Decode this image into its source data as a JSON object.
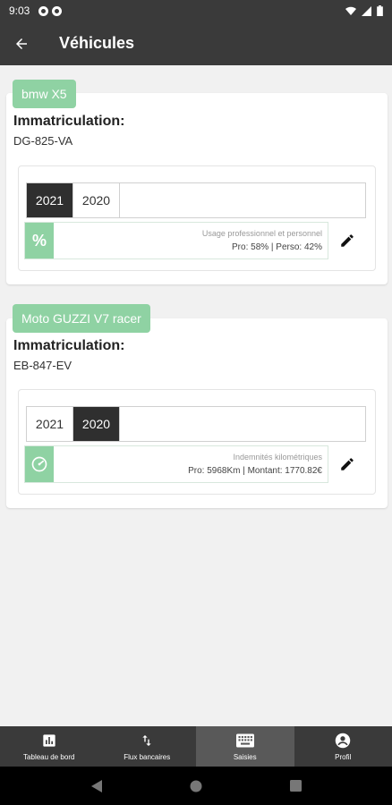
{
  "status_bar": {
    "time": "9:03"
  },
  "app_bar": {
    "title": "Véhicules",
    "back_icon": "arrow-back-icon"
  },
  "vehicles": [
    {
      "name": "bmw X5",
      "registration_label": "Immatriculation:",
      "registration": "DG-825-VA",
      "years": [
        "2021",
        "2020"
      ],
      "selected_year": "2021",
      "info_icon": "percent-icon",
      "info_title": "Usage professionnel et personnel",
      "info_detail": "Pro: 58% | Perso: 42%"
    },
    {
      "name": "Moto GUZZI V7 racer",
      "registration_label": "Immatriculation:",
      "registration": "EB-847-EV",
      "years": [
        "2021",
        "2020"
      ],
      "selected_year": "2020",
      "info_icon": "speedometer-icon",
      "info_title": "Indemnités kilométriques",
      "info_detail": "Pro: 5968Km | Montant: 1770.82€"
    }
  ],
  "bottom_nav": [
    {
      "label": "Tableau de bord",
      "icon": "dashboard-chart-icon"
    },
    {
      "label": "Flux bancaires",
      "icon": "swap-vert-icon"
    },
    {
      "label": "Saisies",
      "icon": "keyboard-icon",
      "active": true
    },
    {
      "label": "Profil",
      "icon": "account-circle-icon"
    }
  ],
  "colors": {
    "bar": "#3a3a3a",
    "accent": "#8fd2a3",
    "active_tab": "#595959"
  }
}
